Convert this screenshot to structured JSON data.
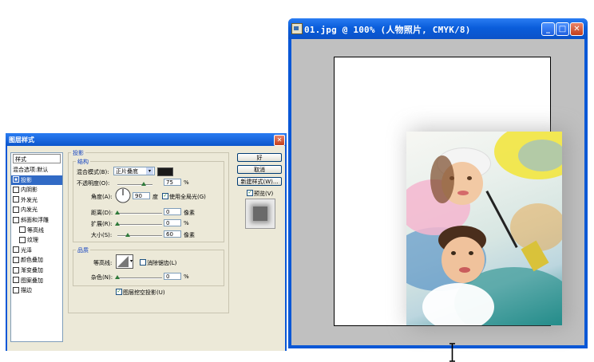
{
  "document": {
    "title": "01.jpg @ 100% (人物照片, CMYK/8)",
    "controls": {
      "minimize": "_",
      "maximize": "□",
      "close": "✕"
    }
  },
  "dialog": {
    "title": "图层样式",
    "close": "✕",
    "styles_header": "样式",
    "styles": [
      {
        "label": "混合选项:默认",
        "has_checkbox": false,
        "checked": false,
        "selected": false,
        "indent": false
      },
      {
        "label": "投影",
        "has_checkbox": true,
        "checked": true,
        "selected": true,
        "indent": false
      },
      {
        "label": "内阴影",
        "has_checkbox": true,
        "checked": false,
        "selected": false,
        "indent": false
      },
      {
        "label": "外发光",
        "has_checkbox": true,
        "checked": false,
        "selected": false,
        "indent": false
      },
      {
        "label": "内发光",
        "has_checkbox": true,
        "checked": false,
        "selected": false,
        "indent": false
      },
      {
        "label": "斜面和浮雕",
        "has_checkbox": true,
        "checked": false,
        "selected": false,
        "indent": false
      },
      {
        "label": "等高线",
        "has_checkbox": true,
        "checked": false,
        "selected": false,
        "indent": true
      },
      {
        "label": "纹理",
        "has_checkbox": true,
        "checked": false,
        "selected": false,
        "indent": true
      },
      {
        "label": "光泽",
        "has_checkbox": true,
        "checked": false,
        "selected": false,
        "indent": false
      },
      {
        "label": "颜色叠加",
        "has_checkbox": true,
        "checked": false,
        "selected": false,
        "indent": false
      },
      {
        "label": "渐变叠加",
        "has_checkbox": true,
        "checked": false,
        "selected": false,
        "indent": false
      },
      {
        "label": "图案叠加",
        "has_checkbox": true,
        "checked": false,
        "selected": false,
        "indent": false
      },
      {
        "label": "描边",
        "has_checkbox": true,
        "checked": false,
        "selected": false,
        "indent": false
      }
    ],
    "drop_shadow": {
      "group_title": "投影",
      "structure_title": "结构",
      "blend_mode_label": "混合模式(B):",
      "blend_mode_value": "正片叠底",
      "shadow_color": "#1a1a1a",
      "opacity_label": "不透明度(O):",
      "opacity_value": "75",
      "opacity_unit": "%",
      "opacity_fraction": 0.75,
      "angle_label": "角度(A):",
      "angle_value": "90",
      "angle_unit": "度",
      "global_light_label": "使用全局光(G)",
      "global_light_checked": true,
      "distance_label": "距离(D):",
      "distance_value": "0",
      "distance_unit": "像素",
      "spread_label": "扩展(R):",
      "spread_value": "0",
      "spread_unit": "%",
      "size_label": "大小(S):",
      "size_value": "60",
      "size_unit": "像素",
      "size_fraction": 0.24,
      "quality_title": "品质",
      "contour_label": "等高线:",
      "antialias_label": "消除锯齿(L)",
      "antialias_checked": false,
      "noise_label": "杂色(N):",
      "noise_value": "0",
      "noise_unit": "%",
      "knockout_label": "图层挖空投影(U)",
      "knockout_checked": true
    },
    "buttons": {
      "ok": "好",
      "cancel": "取消",
      "new_style": "新建样式(W)...",
      "preview_label": "预览(V)",
      "preview_checked": true
    }
  }
}
